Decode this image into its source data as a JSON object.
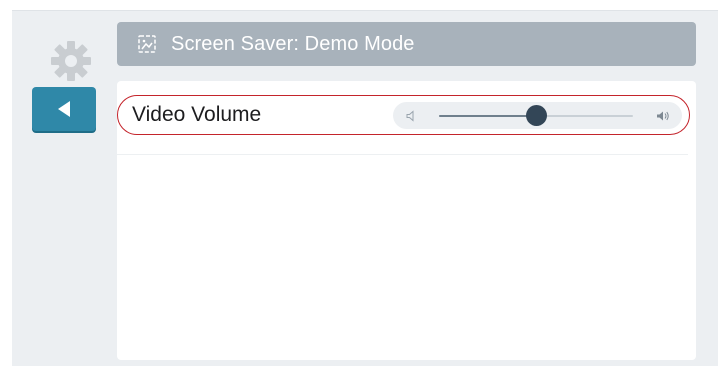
{
  "header": {
    "title": "Screen Saver: Demo Mode",
    "icon": "screensaver-image-icon"
  },
  "nav": {
    "settings_icon": "gear-icon",
    "back_icon": "back-arrow-icon"
  },
  "settings": {
    "video_volume": {
      "label": "Video Volume",
      "value_fraction": 0.5,
      "low_icon": "volume-low-icon",
      "high_icon": "volume-high-icon"
    }
  },
  "colors": {
    "accent": "#2f88a8",
    "header_bg": "#a8b2bb",
    "highlight": "#c4242b",
    "thumb": "#334657",
    "background": "#eceff2"
  }
}
